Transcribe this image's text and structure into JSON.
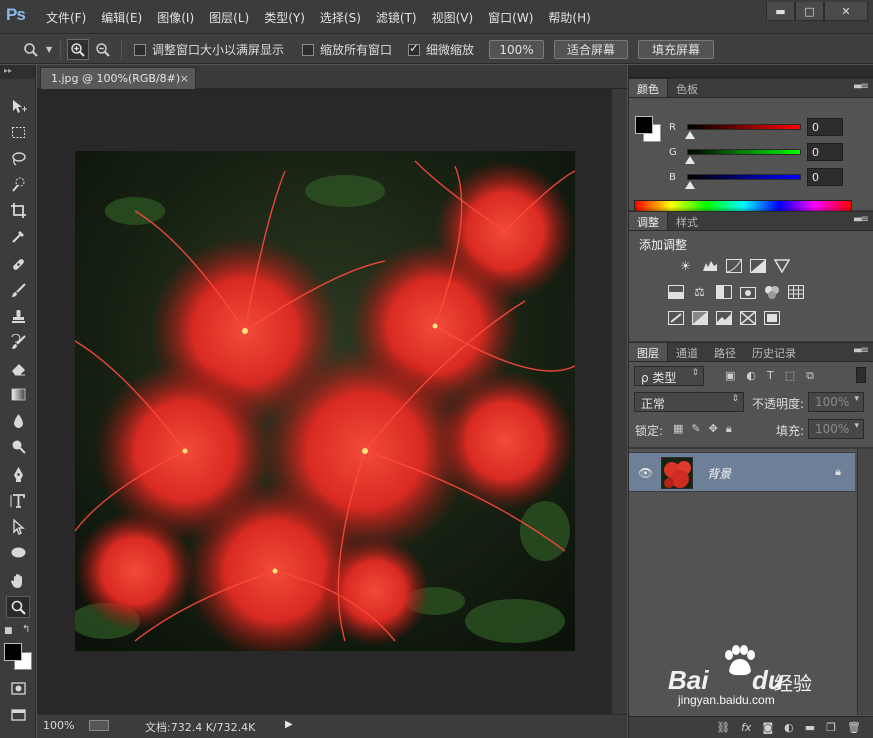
{
  "app": {
    "logo": "Ps"
  },
  "menu": [
    "文件(F)",
    "编辑(E)",
    "图像(I)",
    "图层(L)",
    "类型(Y)",
    "选择(S)",
    "滤镜(T)",
    "视图(V)",
    "窗口(W)",
    "帮助(H)"
  ],
  "window_controls": {
    "minimize": "▬",
    "restore": "□",
    "close": "✕"
  },
  "options": {
    "resize_windows_label": "调整窗口大小以满屏显示",
    "resize_windows_checked": false,
    "zoom_all_label": "缩放所有窗口",
    "zoom_all_checked": false,
    "scrubby_zoom_label": "细微缩放",
    "scrubby_zoom_checked": true,
    "actual_pixels_button": "100%",
    "fit_screen_button": "适合屏幕",
    "fill_screen_button": "填充屏幕"
  },
  "document": {
    "tab_title": "1.jpg @ 100%(RGB/8#)",
    "tab_close": "×",
    "zoom": "100%",
    "doc_info": "文档:732.4 K/732.4K",
    "status_arrow": "▶"
  },
  "color_panel": {
    "tabs": [
      "颜色",
      "色板"
    ],
    "active_tab": 0,
    "channels": [
      {
        "label": "R",
        "value": "0",
        "gradient_end": "#ff0000"
      },
      {
        "label": "G",
        "value": "0",
        "gradient_end": "#00ff00"
      },
      {
        "label": "B",
        "value": "0",
        "gradient_end": "#0000ff"
      }
    ]
  },
  "adjust_panel": {
    "tabs": [
      "调整",
      "样式"
    ],
    "active_tab": 0,
    "title": "添加调整"
  },
  "layers_panel": {
    "tabs": [
      "图层",
      "通道",
      "路径",
      "历史记录"
    ],
    "active_tab": 0,
    "filter_label": "ρ 类型",
    "blend_mode": "正常",
    "opacity_label": "不透明度:",
    "opacity_value": "100%",
    "lock_label": "锁定:",
    "fill_label": "填充:",
    "fill_value": "100%",
    "layers": [
      {
        "name": "背景",
        "visible": true,
        "locked": true
      }
    ]
  },
  "watermark": {
    "brand_left": "Bai",
    "brand_right": "du",
    "cn": "经验",
    "url": "jingyan.baidu.com"
  },
  "colors": {
    "foreground": "#000000",
    "background": "#ffffff",
    "selected_layer": "#6d8097"
  }
}
